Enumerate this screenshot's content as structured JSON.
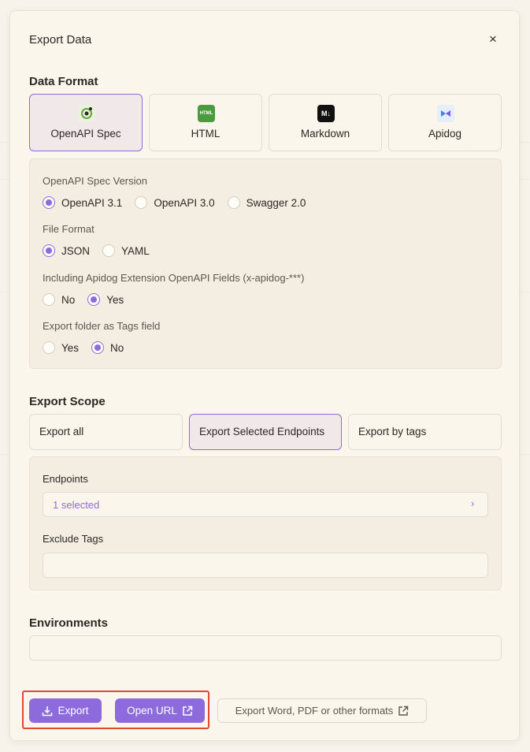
{
  "dialog": {
    "title": "Export Data",
    "close_label": "×"
  },
  "data_format": {
    "title": "Data Format",
    "options": [
      {
        "label": "OpenAPI Spec",
        "icon": "openapi-icon",
        "selected": true
      },
      {
        "label": "HTML",
        "icon": "html-icon",
        "icon_text": "HTML",
        "icon_color": "#4a9b3f"
      },
      {
        "label": "Markdown",
        "icon": "markdown-icon",
        "icon_text": "M↓",
        "icon_color": "#111111"
      },
      {
        "label": "Apidog",
        "icon": "apidog-icon"
      }
    ]
  },
  "openapi_settings": {
    "spec_version": {
      "label": "OpenAPI Spec Version",
      "options": [
        "OpenAPI 3.1",
        "OpenAPI 3.0",
        "Swagger 2.0"
      ],
      "selected": "OpenAPI 3.1"
    },
    "file_format": {
      "label": "File Format",
      "options": [
        "JSON",
        "YAML"
      ],
      "selected": "JSON"
    },
    "extension_fields": {
      "label": "Including Apidog Extension OpenAPI Fields (x-apidog-***)",
      "options": [
        "No",
        "Yes"
      ],
      "selected": "Yes"
    },
    "folder_as_tags": {
      "label": "Export folder as Tags field",
      "options": [
        "Yes",
        "No"
      ],
      "selected": "No"
    }
  },
  "export_scope": {
    "title": "Export Scope",
    "tabs": [
      "Export all",
      "Export Selected Endpoints",
      "Export by tags"
    ],
    "selected": "Export Selected Endpoints",
    "endpoints": {
      "label": "Endpoints",
      "value": "1 selected",
      "chevron": "›"
    },
    "exclude_tags": {
      "label": "Exclude Tags",
      "value": ""
    }
  },
  "environments": {
    "title": "Environments",
    "value": ""
  },
  "actions": {
    "export_label": "Export",
    "open_url_label": "Open URL",
    "other_formats_label": "Export Word, PDF or other formats"
  },
  "colors": {
    "accent": "#8e6bdc",
    "background": "#fbf6ec",
    "highlight": "#e2472f"
  }
}
